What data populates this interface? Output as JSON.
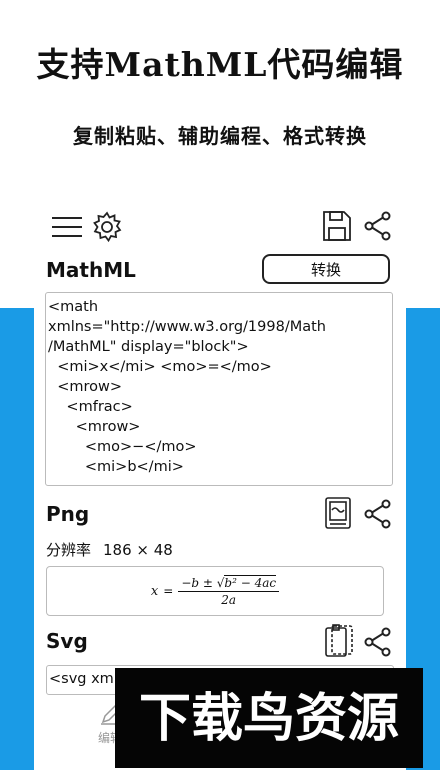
{
  "promo": {
    "headline": "支持MathML代码编辑",
    "subline": "复制粘贴、辅助编程、格式转换"
  },
  "toolbar": {
    "menu_icon": "hamburger-menu-icon",
    "settings_icon": "gear-icon",
    "save_icon": "save-floppy-icon",
    "share_icon": "share-icon"
  },
  "mathml_section": {
    "title": "MathML",
    "convert_label": "转换",
    "code_lines": [
      "<math",
      "xmlns=\"http://www.w3.org/1998/Math",
      "/MathML\" display=\"block\">",
      "  <mi>x</mi> <mo>=</mo>",
      "  <mrow>",
      "    <mfrac>",
      "      <mrow>",
      "        <mo>−</mo>",
      "        <mi>b</mi>"
    ]
  },
  "png_section": {
    "title": "Png",
    "resolution_label": "分辨率",
    "resolution_value": "186 × 48",
    "album_icon": "save-to-gallery-icon",
    "share_icon": "share-icon",
    "formula": {
      "lhs": "x",
      "eq": "=",
      "numerator_prefix": "−b ±",
      "radicand": "b² − 4ac",
      "denominator": "2a"
    }
  },
  "svg_section": {
    "title": "Svg",
    "copy_icon": "copy-clipboard-icon",
    "share_icon": "share-icon",
    "code_preview": "<svg xml"
  },
  "bottom_nav": {
    "edit_icon": "pen-icon",
    "edit_label": "编辑"
  },
  "watermark": {
    "text": "下载鸟资源"
  },
  "colors": {
    "accent_blue": "#1a9be6",
    "text": "#111111",
    "border": "#bbbbbb"
  }
}
